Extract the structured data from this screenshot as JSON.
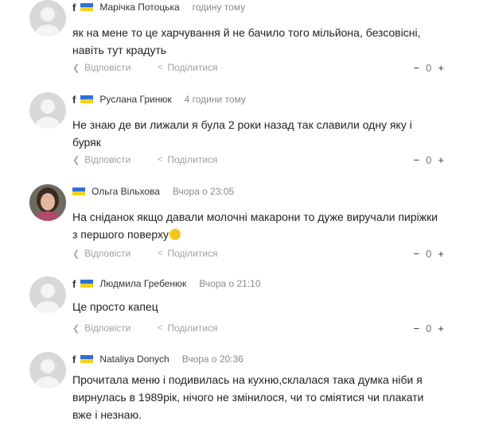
{
  "comments": [
    {
      "name": "Марічка Потоцька",
      "time": "годину тому",
      "facebook": true,
      "avatar": "default-avatar",
      "lines": [
        "як на мене то це харчування й не бачило того мільйона, безсовісні,",
        "навіть тут крадуть"
      ],
      "reply": "Відповісти",
      "share": "Поділитися",
      "minus": "−",
      "count": "0",
      "plus": "+"
    },
    {
      "name": "Руслана Гринюк",
      "time": "4 години тому",
      "facebook": true,
      "avatar": "default-avatar",
      "lines": [
        "Не знаю де ви лижали я була 2 роки назад так славили одну яку і",
        "буряк"
      ],
      "reply": "Відповісти",
      "share": "Поділитися",
      "minus": "−",
      "count": "0",
      "plus": "+"
    },
    {
      "name": "Ольга Вільхова",
      "time": "Вчора о 23:05",
      "facebook": false,
      "avatar": "user-photo",
      "lines": [
        "На сніданок якщо давали молочні макарони то дуже виручали пиріжки",
        "з першого поверху"
      ],
      "reply": "Відповісти",
      "share": "Поділитися",
      "minus": "−",
      "count": "0",
      "plus": "+"
    },
    {
      "name": "Людмила Гребенюк",
      "time": "Вчора о 21:10",
      "facebook": true,
      "avatar": "default-avatar",
      "lines": [
        "Це просто капец"
      ],
      "reply": "Відповісти",
      "share": "Поділитися",
      "minus": "−",
      "count": "0",
      "plus": "+"
    },
    {
      "name": "Nataliya Donych",
      "time": "Вчора о 20:36",
      "facebook": true,
      "avatar": "default-avatar",
      "lines": [
        "Прочитала  меню і подивилась  на кухню,склалася така думка ніби я",
        "вирнулась в 1989рік, нічого не змінилося, чи то сміятися  чи плакати",
        "вже і незнаю."
      ]
    }
  ],
  "colors": {
    "flag_blue": "#2f6fd6",
    "flag_yellow": "#f2d21b",
    "muted": "#a0a0a0"
  }
}
